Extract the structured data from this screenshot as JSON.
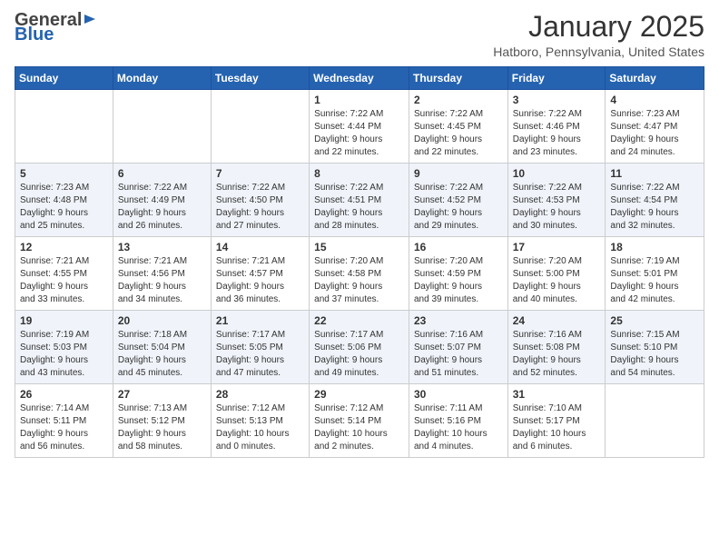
{
  "header": {
    "logo_general": "General",
    "logo_blue": "Blue",
    "month_title": "January 2025",
    "location": "Hatboro, Pennsylvania, United States"
  },
  "days_of_week": [
    "Sunday",
    "Monday",
    "Tuesday",
    "Wednesday",
    "Thursday",
    "Friday",
    "Saturday"
  ],
  "weeks": [
    [
      {
        "day": "",
        "info": ""
      },
      {
        "day": "",
        "info": ""
      },
      {
        "day": "",
        "info": ""
      },
      {
        "day": "1",
        "info": "Sunrise: 7:22 AM\nSunset: 4:44 PM\nDaylight: 9 hours\nand 22 minutes."
      },
      {
        "day": "2",
        "info": "Sunrise: 7:22 AM\nSunset: 4:45 PM\nDaylight: 9 hours\nand 22 minutes."
      },
      {
        "day": "3",
        "info": "Sunrise: 7:22 AM\nSunset: 4:46 PM\nDaylight: 9 hours\nand 23 minutes."
      },
      {
        "day": "4",
        "info": "Sunrise: 7:23 AM\nSunset: 4:47 PM\nDaylight: 9 hours\nand 24 minutes."
      }
    ],
    [
      {
        "day": "5",
        "info": "Sunrise: 7:23 AM\nSunset: 4:48 PM\nDaylight: 9 hours\nand 25 minutes."
      },
      {
        "day": "6",
        "info": "Sunrise: 7:22 AM\nSunset: 4:49 PM\nDaylight: 9 hours\nand 26 minutes."
      },
      {
        "day": "7",
        "info": "Sunrise: 7:22 AM\nSunset: 4:50 PM\nDaylight: 9 hours\nand 27 minutes."
      },
      {
        "day": "8",
        "info": "Sunrise: 7:22 AM\nSunset: 4:51 PM\nDaylight: 9 hours\nand 28 minutes."
      },
      {
        "day": "9",
        "info": "Sunrise: 7:22 AM\nSunset: 4:52 PM\nDaylight: 9 hours\nand 29 minutes."
      },
      {
        "day": "10",
        "info": "Sunrise: 7:22 AM\nSunset: 4:53 PM\nDaylight: 9 hours\nand 30 minutes."
      },
      {
        "day": "11",
        "info": "Sunrise: 7:22 AM\nSunset: 4:54 PM\nDaylight: 9 hours\nand 32 minutes."
      }
    ],
    [
      {
        "day": "12",
        "info": "Sunrise: 7:21 AM\nSunset: 4:55 PM\nDaylight: 9 hours\nand 33 minutes."
      },
      {
        "day": "13",
        "info": "Sunrise: 7:21 AM\nSunset: 4:56 PM\nDaylight: 9 hours\nand 34 minutes."
      },
      {
        "day": "14",
        "info": "Sunrise: 7:21 AM\nSunset: 4:57 PM\nDaylight: 9 hours\nand 36 minutes."
      },
      {
        "day": "15",
        "info": "Sunrise: 7:20 AM\nSunset: 4:58 PM\nDaylight: 9 hours\nand 37 minutes."
      },
      {
        "day": "16",
        "info": "Sunrise: 7:20 AM\nSunset: 4:59 PM\nDaylight: 9 hours\nand 39 minutes."
      },
      {
        "day": "17",
        "info": "Sunrise: 7:20 AM\nSunset: 5:00 PM\nDaylight: 9 hours\nand 40 minutes."
      },
      {
        "day": "18",
        "info": "Sunrise: 7:19 AM\nSunset: 5:01 PM\nDaylight: 9 hours\nand 42 minutes."
      }
    ],
    [
      {
        "day": "19",
        "info": "Sunrise: 7:19 AM\nSunset: 5:03 PM\nDaylight: 9 hours\nand 43 minutes."
      },
      {
        "day": "20",
        "info": "Sunrise: 7:18 AM\nSunset: 5:04 PM\nDaylight: 9 hours\nand 45 minutes."
      },
      {
        "day": "21",
        "info": "Sunrise: 7:17 AM\nSunset: 5:05 PM\nDaylight: 9 hours\nand 47 minutes."
      },
      {
        "day": "22",
        "info": "Sunrise: 7:17 AM\nSunset: 5:06 PM\nDaylight: 9 hours\nand 49 minutes."
      },
      {
        "day": "23",
        "info": "Sunrise: 7:16 AM\nSunset: 5:07 PM\nDaylight: 9 hours\nand 51 minutes."
      },
      {
        "day": "24",
        "info": "Sunrise: 7:16 AM\nSunset: 5:08 PM\nDaylight: 9 hours\nand 52 minutes."
      },
      {
        "day": "25",
        "info": "Sunrise: 7:15 AM\nSunset: 5:10 PM\nDaylight: 9 hours\nand 54 minutes."
      }
    ],
    [
      {
        "day": "26",
        "info": "Sunrise: 7:14 AM\nSunset: 5:11 PM\nDaylight: 9 hours\nand 56 minutes."
      },
      {
        "day": "27",
        "info": "Sunrise: 7:13 AM\nSunset: 5:12 PM\nDaylight: 9 hours\nand 58 minutes."
      },
      {
        "day": "28",
        "info": "Sunrise: 7:12 AM\nSunset: 5:13 PM\nDaylight: 10 hours\nand 0 minutes."
      },
      {
        "day": "29",
        "info": "Sunrise: 7:12 AM\nSunset: 5:14 PM\nDaylight: 10 hours\nand 2 minutes."
      },
      {
        "day": "30",
        "info": "Sunrise: 7:11 AM\nSunset: 5:16 PM\nDaylight: 10 hours\nand 4 minutes."
      },
      {
        "day": "31",
        "info": "Sunrise: 7:10 AM\nSunset: 5:17 PM\nDaylight: 10 hours\nand 6 minutes."
      },
      {
        "day": "",
        "info": ""
      }
    ]
  ]
}
